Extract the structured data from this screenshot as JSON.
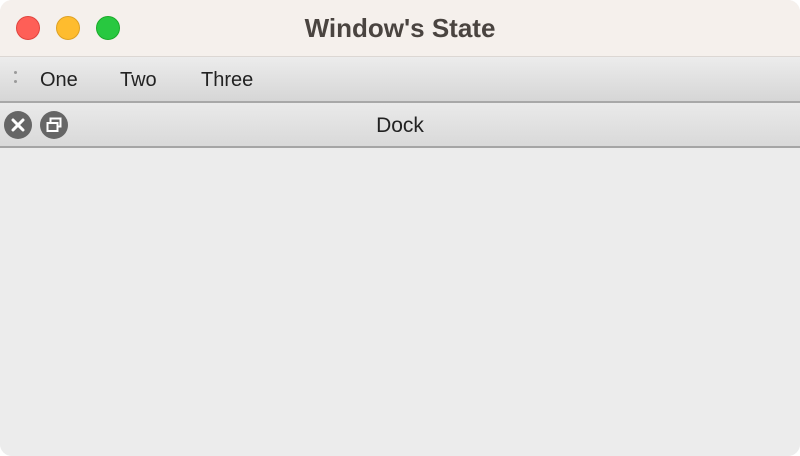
{
  "window": {
    "title": "Window's State",
    "traffic_lights": {
      "close": {
        "icon": "close-traffic-light",
        "color": "#fe5f57"
      },
      "minimize": {
        "icon": "minimize-traffic-light",
        "color": "#febc2e"
      },
      "maximize": {
        "icon": "maximize-traffic-light",
        "color": "#28c840"
      }
    }
  },
  "toolbar": {
    "handle_icon": "toolbar-grip-icon",
    "buttons": [
      {
        "label": "One"
      },
      {
        "label": "Two"
      },
      {
        "label": "Three"
      }
    ]
  },
  "dock": {
    "title": "Dock",
    "close_icon": "close-circle-icon",
    "float_icon": "float-restore-icon",
    "button_color": "#666666"
  }
}
